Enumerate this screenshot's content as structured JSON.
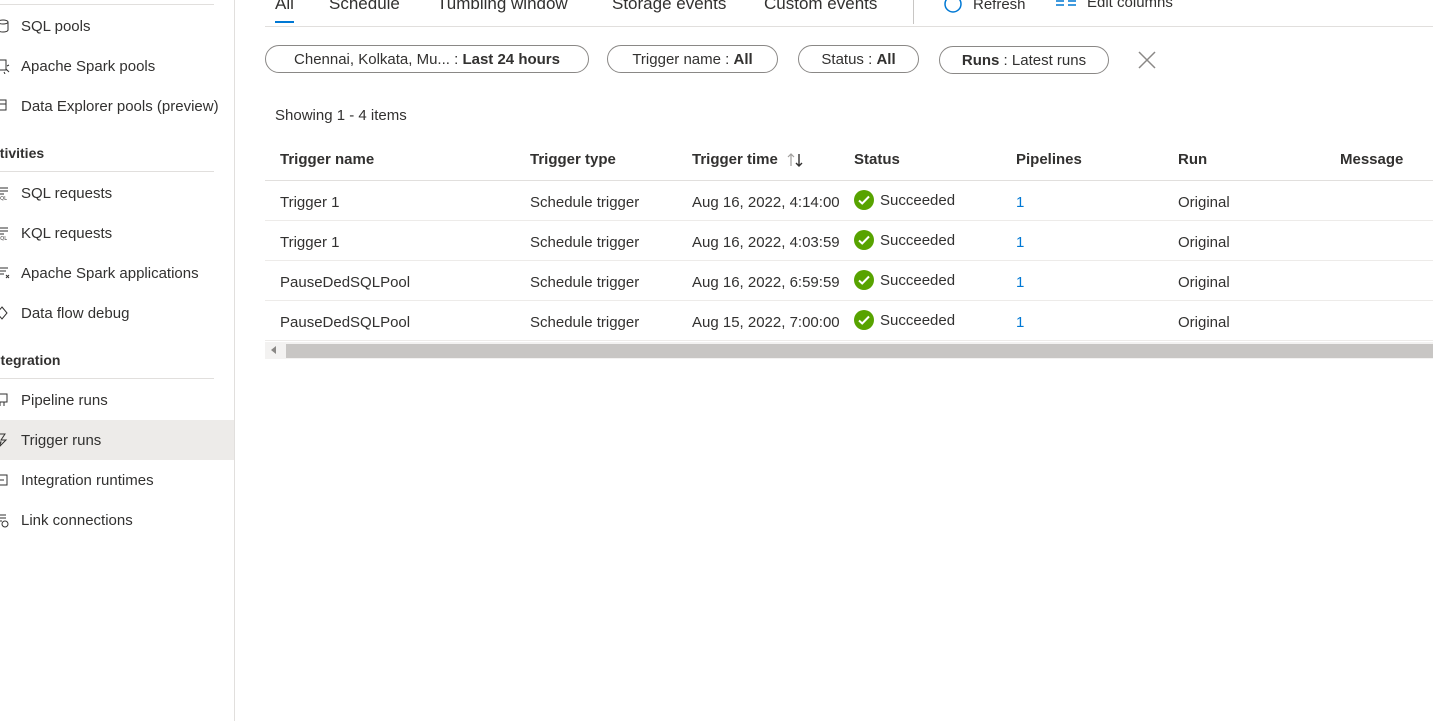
{
  "sidebar": {
    "pools": [
      {
        "label": "SQL pools",
        "icon": "database-icon"
      },
      {
        "label": "Apache Spark pools",
        "icon": "spark-pool-icon"
      },
      {
        "label": "Data Explorer pools (preview)",
        "icon": "data-explorer-icon"
      }
    ],
    "activities_heading": "ctivities",
    "activities": [
      {
        "label": "SQL requests",
        "icon": "sql-requests-icon"
      },
      {
        "label": "KQL requests",
        "icon": "kql-requests-icon"
      },
      {
        "label": "Apache Spark applications",
        "icon": "spark-applications-icon"
      },
      {
        "label": "Data flow debug",
        "icon": "data-flow-debug-icon"
      }
    ],
    "integration_heading": "ntegration",
    "integration": [
      {
        "label": "Pipeline runs",
        "icon": "pipeline-runs-icon"
      },
      {
        "label": "Trigger runs",
        "icon": "trigger-runs-icon",
        "active": true
      },
      {
        "label": "Integration runtimes",
        "icon": "integration-runtimes-icon"
      },
      {
        "label": "Link connections",
        "icon": "link-connections-icon"
      }
    ]
  },
  "tabs": [
    {
      "label": "All",
      "selected": true
    },
    {
      "label": "Schedule"
    },
    {
      "label": "Tumbling window"
    },
    {
      "label": "Storage events"
    },
    {
      "label": "Custom events"
    }
  ],
  "toolbar": {
    "refresh_label": "Refresh",
    "edit_columns_label": "Edit columns"
  },
  "filters": {
    "time": {
      "prefix": "Chennai, Kolkata, Mu...",
      "sep": " : ",
      "value": "Last 24 hours"
    },
    "trigger_name": {
      "prefix": "Trigger name",
      "sep": " : ",
      "value": "All"
    },
    "status": {
      "prefix": "Status",
      "sep": " : ",
      "value": "All"
    },
    "runs": {
      "prefix": "Runs",
      "sep": " : ",
      "value": "Latest runs"
    }
  },
  "showing_text": "Showing 1 - 4 items",
  "table": {
    "columns": [
      "Trigger name",
      "Trigger type",
      "Trigger time",
      "Status",
      "Pipelines",
      "Run",
      "Message"
    ],
    "rows": [
      {
        "name": "Trigger 1",
        "type": "Schedule trigger",
        "time": "Aug 16, 2022, 4:14:00",
        "status": "Succeeded",
        "pipelines": "1",
        "run": "Original"
      },
      {
        "name": "Trigger 1",
        "type": "Schedule trigger",
        "time": "Aug 16, 2022, 4:03:59",
        "status": "Succeeded",
        "pipelines": "1",
        "run": "Original"
      },
      {
        "name": "PauseDedSQLPool",
        "type": "Schedule trigger",
        "time": "Aug 16, 2022, 6:59:59",
        "status": "Succeeded",
        "pipelines": "1",
        "run": "Original"
      },
      {
        "name": "PauseDedSQLPool",
        "type": "Schedule trigger",
        "time": "Aug 15, 2022, 7:00:00",
        "status": "Succeeded",
        "pipelines": "1",
        "run": "Original"
      }
    ]
  },
  "colors": {
    "accent": "#0078d4",
    "success": "#57a300",
    "active_bg": "#edebe9"
  }
}
